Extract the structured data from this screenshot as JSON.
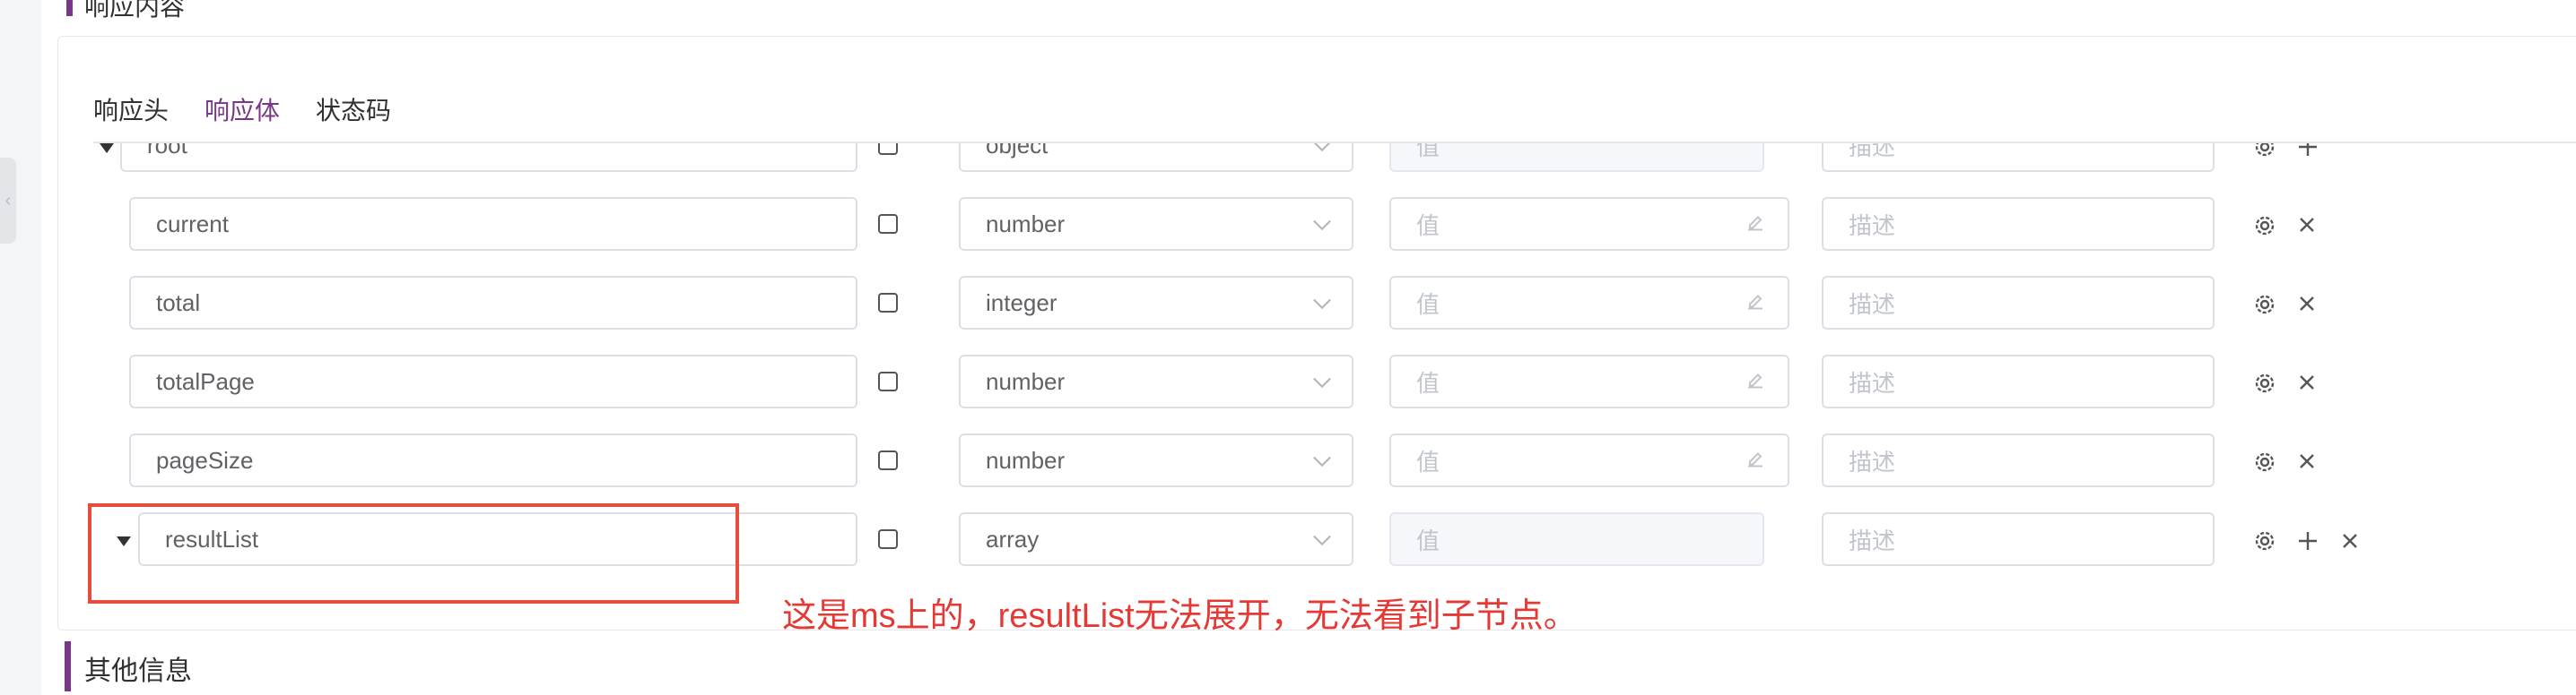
{
  "sections": {
    "top_title": "响应内容",
    "bottom_title": "其他信息"
  },
  "tabs": [
    {
      "label": "响应头",
      "active": false
    },
    {
      "label": "响应体",
      "active": true
    },
    {
      "label": "状态码",
      "active": false
    }
  ],
  "rows": [
    {
      "name": "root",
      "type": "object",
      "value_placeholder": "值",
      "desc_placeholder": "描述",
      "expandable": true,
      "actions": [
        "gear-icon",
        "plus-icon"
      ]
    },
    {
      "name": "current",
      "type": "number",
      "value_placeholder": "值",
      "desc_placeholder": "描述",
      "expandable": false,
      "actions": [
        "gear-icon",
        "close-icon"
      ]
    },
    {
      "name": "total",
      "type": "integer",
      "value_placeholder": "值",
      "desc_placeholder": "描述",
      "expandable": false,
      "actions": [
        "gear-icon",
        "close-icon"
      ]
    },
    {
      "name": "totalPage",
      "type": "number",
      "value_placeholder": "值",
      "desc_placeholder": "描述",
      "expandable": false,
      "actions": [
        "gear-icon",
        "close-icon"
      ]
    },
    {
      "name": "pageSize",
      "type": "number",
      "value_placeholder": "值",
      "desc_placeholder": "描述",
      "expandable": false,
      "actions": [
        "gear-icon",
        "close-icon"
      ]
    },
    {
      "name": "resultList",
      "type": "array",
      "value_placeholder": "值",
      "desc_placeholder": "描述",
      "expandable": true,
      "actions": [
        "gear-icon",
        "plus-icon",
        "close-icon"
      ]
    }
  ],
  "annotation": "这是ms上的，resultList无法展开，无法看到子节点。",
  "colors": {
    "accent": "#783887",
    "annotation": "#e53935",
    "border": "#dcdfe6"
  }
}
